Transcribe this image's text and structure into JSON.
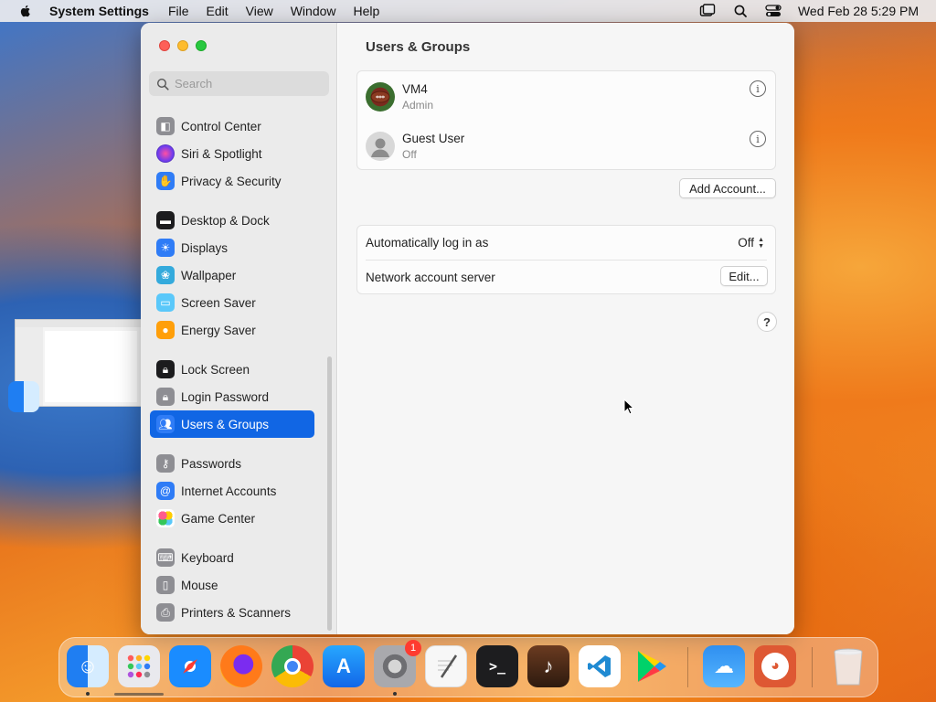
{
  "menubar": {
    "app_name": "System Settings",
    "items": [
      "File",
      "Edit",
      "View",
      "Window",
      "Help"
    ],
    "clock": "Wed Feb 28  5:29 PM"
  },
  "sidebar": {
    "search_placeholder": "Search",
    "items": [
      {
        "label": "Control Center",
        "icon": "control-center-icon",
        "color": "#8e8e93"
      },
      {
        "label": "Siri & Spotlight",
        "icon": "siri-icon",
        "color": "#b53bd6"
      },
      {
        "label": "Privacy & Security",
        "icon": "hand-icon",
        "color": "#2f7cf6"
      },
      {
        "label": "Desktop & Dock",
        "icon": "dock-icon",
        "color": "#1c1c1e"
      },
      {
        "label": "Displays",
        "icon": "sun-icon",
        "color": "#2f7cf6"
      },
      {
        "label": "Wallpaper",
        "icon": "flower-icon",
        "color": "#34aadc"
      },
      {
        "label": "Screen Saver",
        "icon": "screen-saver-icon",
        "color": "#5ac8fa"
      },
      {
        "label": "Energy Saver",
        "icon": "bulb-icon",
        "color": "#ff9f0a"
      },
      {
        "label": "Lock Screen",
        "icon": "lock-icon",
        "color": "#1c1c1e"
      },
      {
        "label": "Login Password",
        "icon": "lock-icon",
        "color": "#8e8e93"
      },
      {
        "label": "Users & Groups",
        "icon": "users-icon",
        "color": "#2f7cf6"
      },
      {
        "label": "Passwords",
        "icon": "key-icon",
        "color": "#8e8e93"
      },
      {
        "label": "Internet Accounts",
        "icon": "at-icon",
        "color": "#2f7cf6"
      },
      {
        "label": "Game Center",
        "icon": "game-center-icon",
        "color": "#ffffff"
      },
      {
        "label": "Keyboard",
        "icon": "keyboard-icon",
        "color": "#8e8e93"
      },
      {
        "label": "Mouse",
        "icon": "mouse-icon",
        "color": "#8e8e93"
      },
      {
        "label": "Printers & Scanners",
        "icon": "printer-icon",
        "color": "#8e8e93"
      }
    ],
    "active": "Users & Groups"
  },
  "main": {
    "title": "Users & Groups",
    "users": [
      {
        "name": "VM4",
        "role": "Admin",
        "avatar": "football-avatar"
      },
      {
        "name": "Guest User",
        "role": "Off",
        "avatar": "person-icon"
      }
    ],
    "add_account_label": "Add Account...",
    "auto_login_label": "Automatically log in as",
    "auto_login_value": "Off",
    "network_server_label": "Network account server",
    "edit_label": "Edit...",
    "help_label": "?"
  },
  "dock": {
    "apps": [
      {
        "name": "Finder",
        "icon": "finder-icon",
        "color": "#1f7ef2"
      },
      {
        "name": "Launchpad",
        "icon": "launchpad-icon",
        "color": "#e9e9ee"
      },
      {
        "name": "Safari",
        "icon": "safari-icon",
        "color": "#1a8cff"
      },
      {
        "name": "Firefox",
        "icon": "firefox-icon",
        "color": "#ff7a1a"
      },
      {
        "name": "Chrome",
        "icon": "chrome-icon",
        "color": "#ffffff"
      },
      {
        "name": "App Store",
        "icon": "app-store-icon",
        "color": "#1e8ff5"
      },
      {
        "name": "System Settings",
        "icon": "gear-icon",
        "color": "#8a8a8e"
      },
      {
        "name": "TextEdit",
        "icon": "textedit-icon",
        "color": "#f7f7f7"
      },
      {
        "name": "Terminal",
        "icon": "terminal-icon",
        "color": "#1d1d1f"
      },
      {
        "name": "GarageBand",
        "icon": "guitar-icon",
        "color": "#4a2a1a"
      },
      {
        "name": "VS Code",
        "icon": "vscode-icon",
        "color": "#ffffff"
      },
      {
        "name": "Play Store",
        "icon": "play-icon",
        "color": "#ffffff"
      },
      {
        "name": "Weather",
        "icon": "weather-icon",
        "color": "#2f8ff0"
      },
      {
        "name": "DuckDuckGo",
        "icon": "duck-icon",
        "color": "#de5833"
      },
      {
        "name": "Trash",
        "icon": "trash-icon",
        "color": "#e8e8ea"
      }
    ],
    "settings_badge": "1"
  }
}
